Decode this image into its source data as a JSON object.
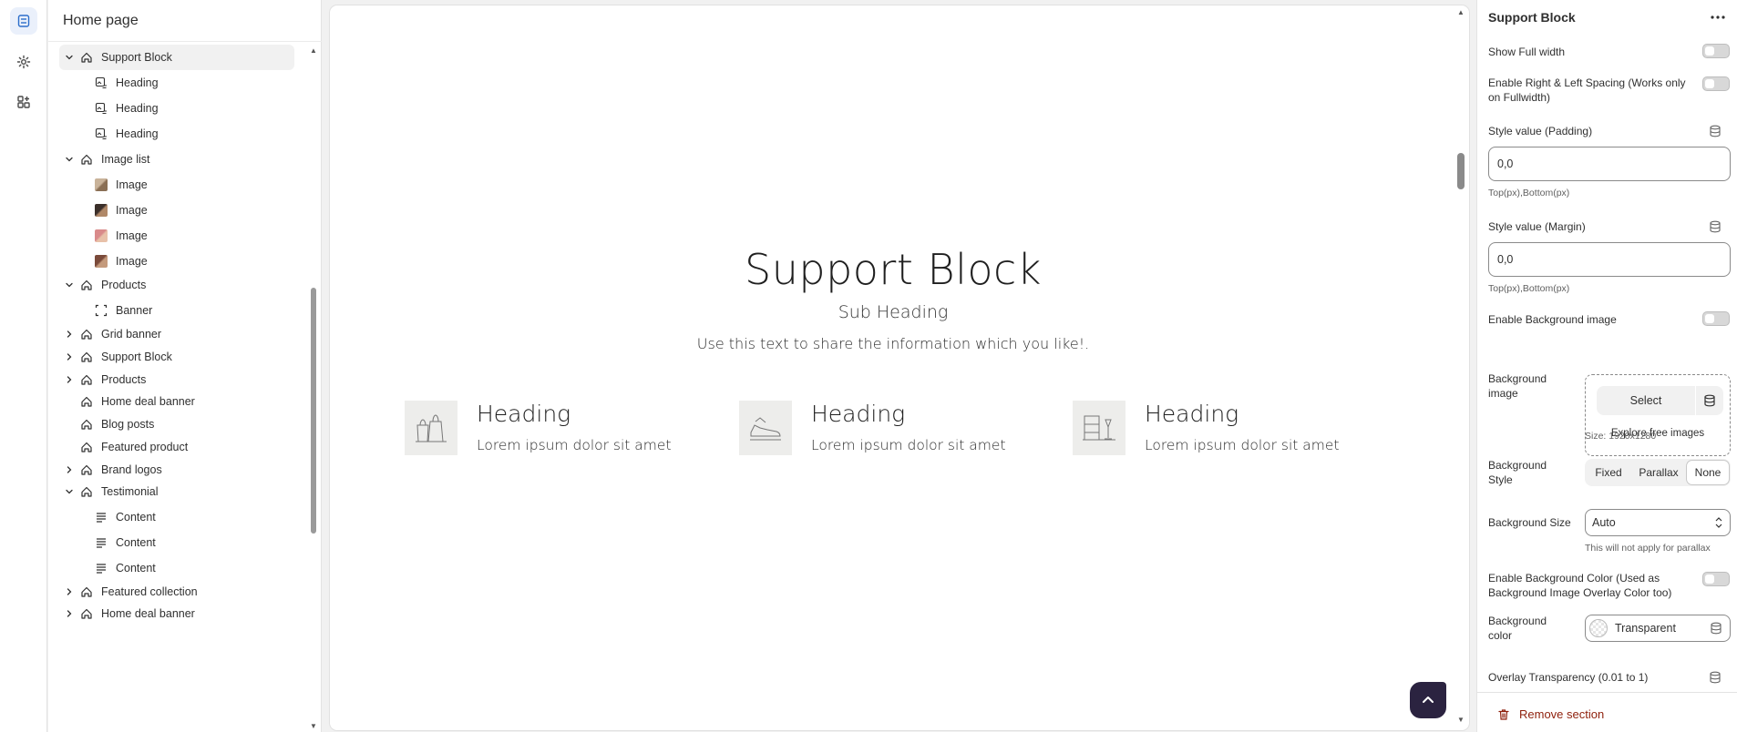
{
  "sidebar": {
    "title": "Home page",
    "tree": [
      {
        "label": "Support Block",
        "level": "section",
        "expanded": true,
        "icon": "section-icon",
        "selected": true
      },
      {
        "label": "Heading",
        "level": "block",
        "icon": "image-text-icon"
      },
      {
        "label": "Heading",
        "level": "block",
        "icon": "image-text-icon"
      },
      {
        "label": "Heading",
        "level": "block",
        "icon": "image-text-icon"
      },
      {
        "label": "Image list",
        "level": "section",
        "expanded": true,
        "icon": "section-icon"
      },
      {
        "label": "Image",
        "level": "block",
        "icon": "image-thumbnail"
      },
      {
        "label": "Image",
        "level": "block",
        "icon": "image-thumbnail"
      },
      {
        "label": "Image",
        "level": "block",
        "icon": "image-thumbnail"
      },
      {
        "label": "Image",
        "level": "block",
        "icon": "image-thumbnail"
      },
      {
        "label": "Products",
        "level": "section",
        "expanded": true,
        "icon": "section-icon"
      },
      {
        "label": "Banner",
        "level": "block",
        "icon": "banner-icon"
      },
      {
        "label": "Grid banner",
        "level": "section",
        "expanded": false,
        "icon": "section-icon"
      },
      {
        "label": "Support Block",
        "level": "section",
        "expanded": false,
        "icon": "section-icon"
      },
      {
        "label": "Products",
        "level": "section",
        "expanded": false,
        "icon": "section-icon"
      },
      {
        "label": "Home deal banner",
        "level": "section",
        "icon": "section-icon"
      },
      {
        "label": "Blog posts",
        "level": "section",
        "icon": "section-icon"
      },
      {
        "label": "Featured product",
        "level": "section",
        "icon": "section-icon"
      },
      {
        "label": "Brand logos",
        "level": "section",
        "expanded": false,
        "icon": "section-icon"
      },
      {
        "label": "Testimonial",
        "level": "section",
        "expanded": true,
        "icon": "section-icon"
      },
      {
        "label": "Content",
        "level": "block",
        "icon": "text-lines-icon"
      },
      {
        "label": "Content",
        "level": "block",
        "icon": "text-lines-icon"
      },
      {
        "label": "Content",
        "level": "block",
        "icon": "text-lines-icon"
      },
      {
        "label": "Featured collection",
        "level": "section",
        "expanded": false,
        "icon": "section-icon"
      },
      {
        "label": "Home deal banner",
        "level": "section",
        "expanded": false,
        "icon": "section-icon"
      }
    ]
  },
  "preview": {
    "title": "Support Block",
    "subheading": "Sub Heading",
    "text": "Use this text to share the information which you like!.",
    "features": [
      {
        "heading": "Heading",
        "text": "Lorem ipsum dolor sit amet",
        "icon": "shopping-bags-icon"
      },
      {
        "heading": "Heading",
        "text": "Lorem ipsum dolor sit amet",
        "icon": "shoes-icon"
      },
      {
        "heading": "Heading",
        "text": "Lorem ipsum dolor sit amet",
        "icon": "shelf-decor-icon"
      }
    ],
    "scroll_top_icon": "chevron-up-icon",
    "accent_color": "#2b2340"
  },
  "settings": {
    "title": "Support Block",
    "show_full_width": "Show Full width",
    "enable_spacing": "Enable Right & Left Spacing (Works only on Fullwidth)",
    "padding_label": "Style value (Padding)",
    "padding_value": "0,0",
    "padding_hint": "Top(px),Bottom(px)",
    "margin_label": "Style value (Margin)",
    "margin_value": "0,0",
    "margin_hint": "Top(px),Bottom(px)",
    "enable_bg_image": "Enable Background image",
    "bg_image_label": "Background image",
    "select_label": "Select",
    "explore_label": "Explore free images",
    "size_hint": "Size: 1920x1280",
    "bg_style_label": "Background Style",
    "bg_style_options": [
      "Fixed",
      "Parallax",
      "None"
    ],
    "bg_style_selected": "None",
    "bg_size_label": "Background Size",
    "bg_size_value": "Auto",
    "bg_size_hint": "This will not apply for parallax",
    "enable_bg_color": "Enable Background Color (Used as Background Image Overlay Color too)",
    "bg_color_label": "Background color",
    "bg_color_value": "Transparent",
    "overlay_label": "Overlay Transparency (0.01 to 1)",
    "remove_label": "Remove section",
    "danger_color": "#8e1f0b"
  }
}
